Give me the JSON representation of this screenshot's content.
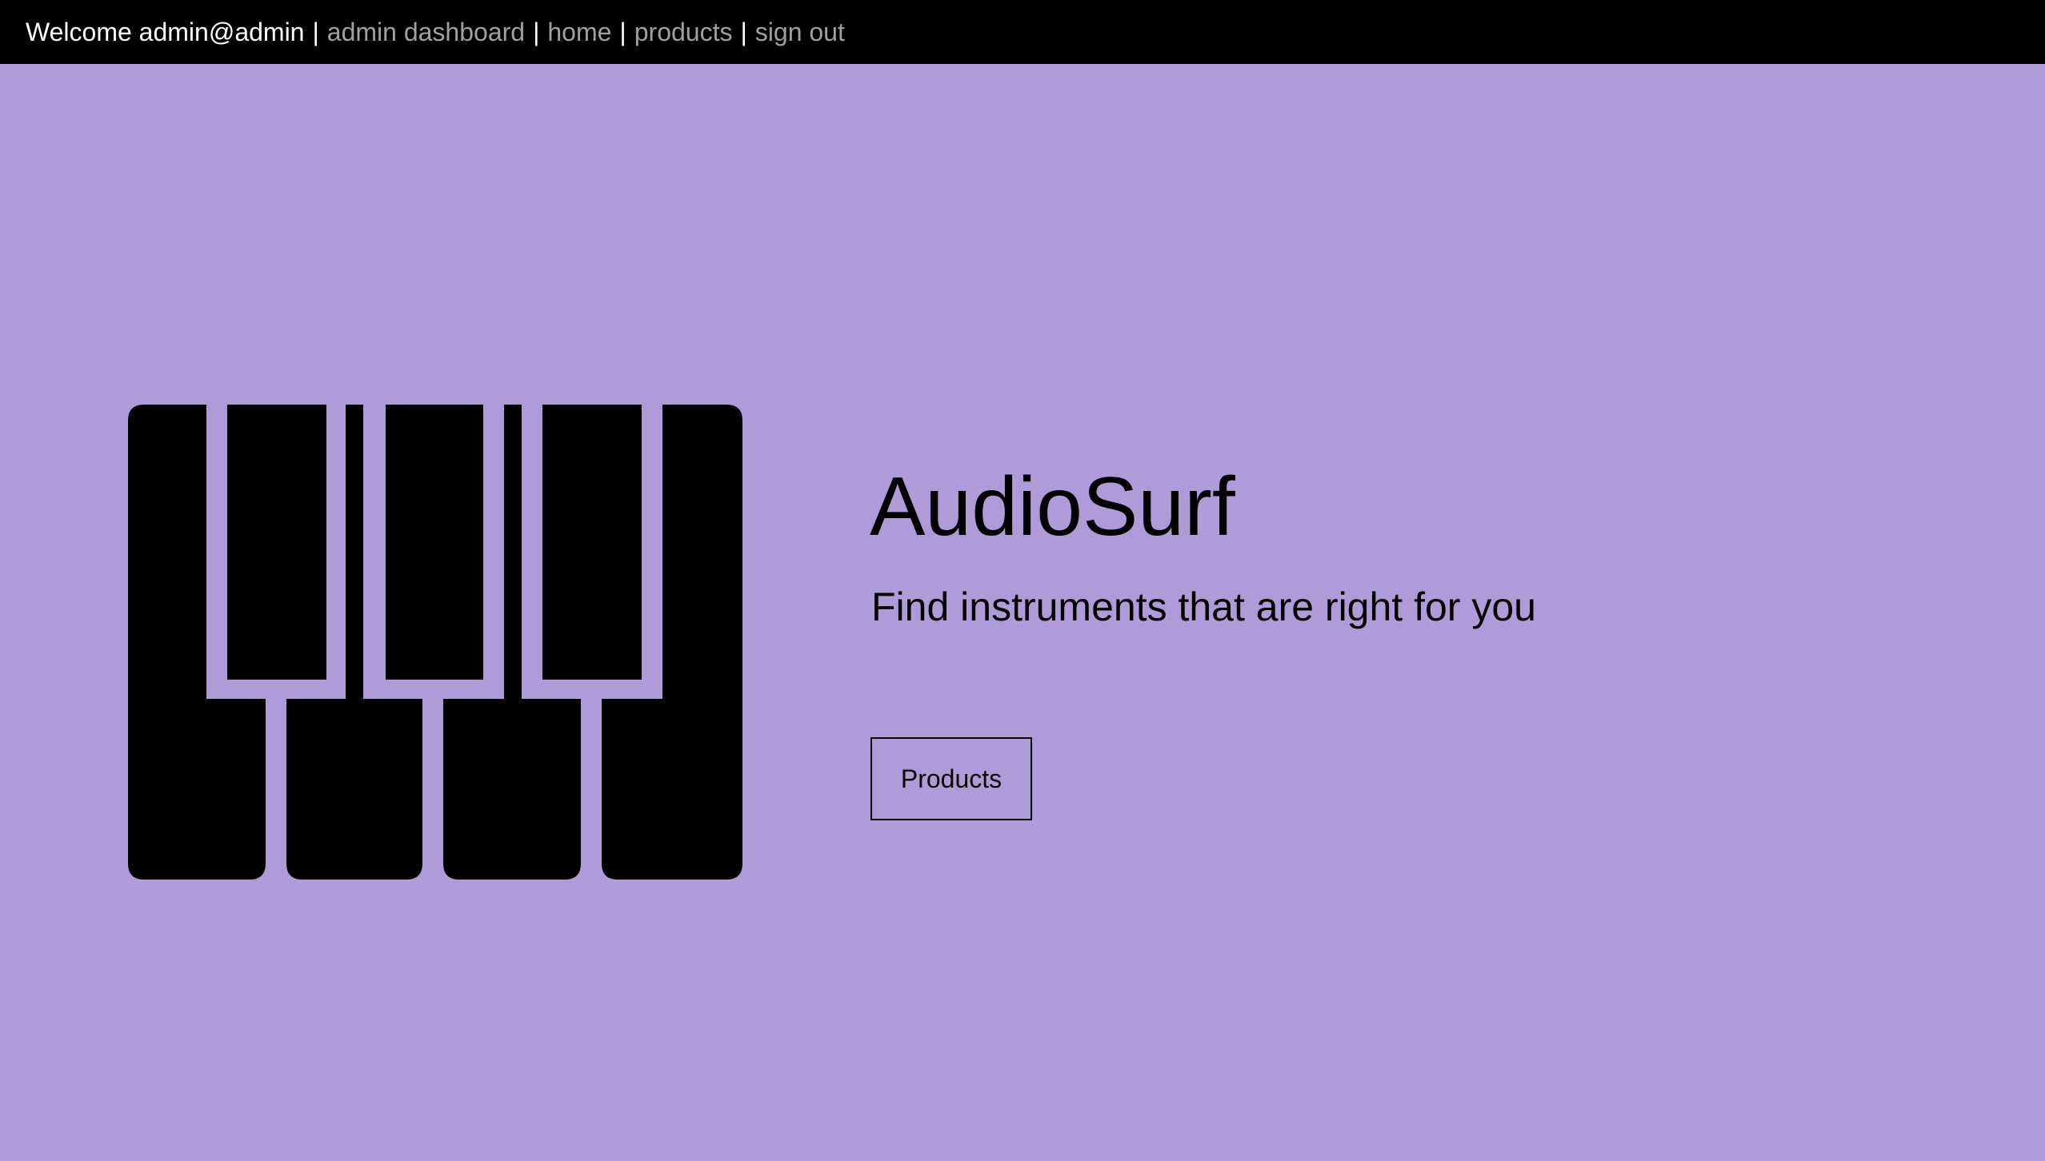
{
  "nav": {
    "welcome": "Welcome admin@admin",
    "separator": "|",
    "links": [
      "admin dashboard",
      "home",
      "products",
      "sign out"
    ]
  },
  "hero": {
    "logo_icon": "piano-keys-icon",
    "title": "AudioSurf",
    "subtitle": "Find instruments that are right for you",
    "button_label": "Products"
  },
  "colors": {
    "background": "#b09bd9",
    "topbar": "#000000",
    "nav_link": "#a0a0a0",
    "text": "#000000"
  }
}
